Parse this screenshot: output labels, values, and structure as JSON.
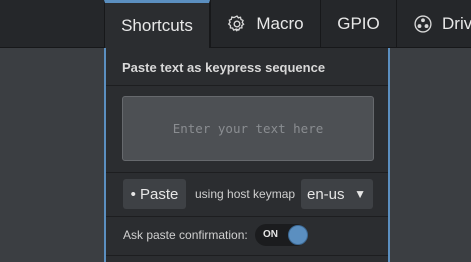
{
  "tabs": [
    {
      "label": "Shortcuts",
      "active": true
    },
    {
      "label": "Macro",
      "icon": "gear-icon"
    },
    {
      "label": "GPIO"
    },
    {
      "label": "Drive",
      "icon": "drive-icon"
    }
  ],
  "paste_panel": {
    "title": "Paste text as keypress sequence",
    "text_placeholder": "Enter your text here",
    "paste_button": "• Paste",
    "keymap_hint": "using host keymap",
    "keymap_value": "en-us",
    "confirm_label": "Ask paste confirmation:",
    "confirm_toggle": "ON"
  },
  "colors": {
    "accent": "#5b8fc0",
    "background": "#3b3e42",
    "panel": "#2b2d30",
    "topbar": "#25272a"
  }
}
